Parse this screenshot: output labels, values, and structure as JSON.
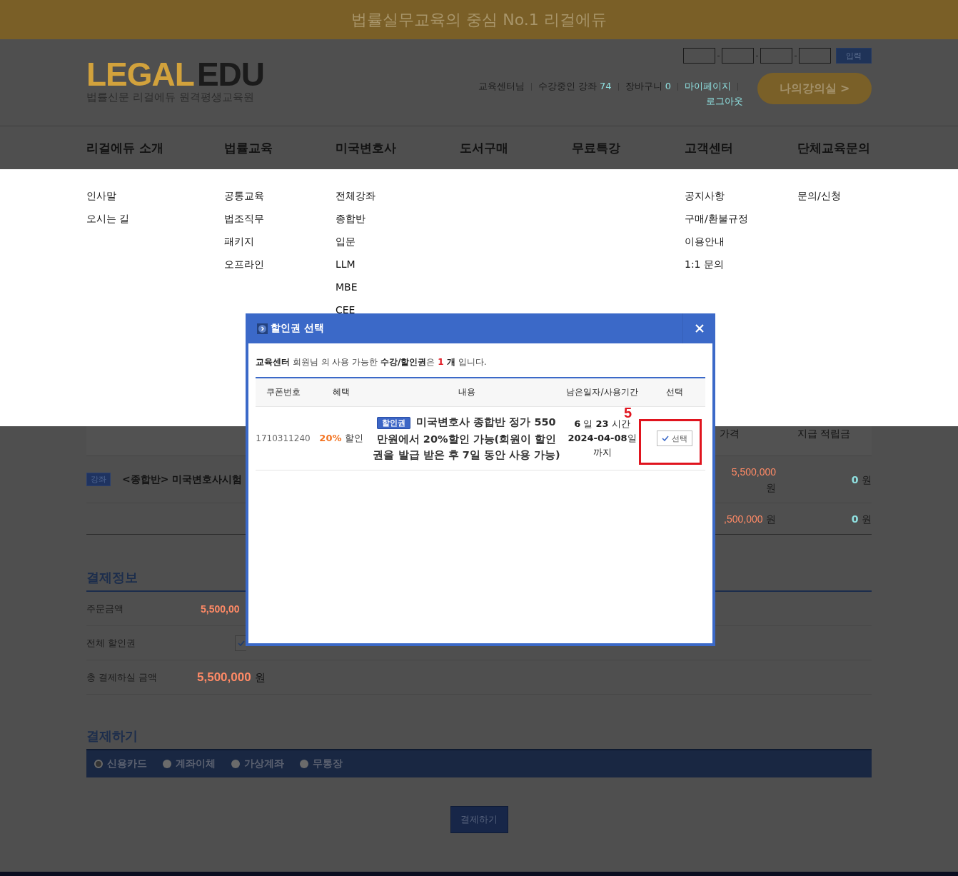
{
  "banner": {
    "text": "법률실무교육의 중심 No.1 리걸에듀"
  },
  "header": {
    "logo": {
      "brand_a": "LEGAL",
      "brand_b": "EDU",
      "subtitle": "법률신문 리걸에듀 원격평생교육원"
    },
    "code_submit": "입력",
    "user_links": [
      {
        "kind": "plain",
        "label": "교육센터님"
      },
      {
        "kind": "count",
        "label": "수강중인 강좌",
        "count": "74"
      },
      {
        "kind": "count",
        "label": "장바구니",
        "count": "0"
      },
      {
        "kind": "link",
        "label": "마이페이지"
      },
      {
        "kind": "logout",
        "label": "로그아웃"
      }
    ],
    "classroom_button": "나의강의실 >"
  },
  "nav": [
    {
      "label": "리걸에듀 소개",
      "submenu": [
        "인사말",
        "오시는 길"
      ]
    },
    {
      "label": "법률교육",
      "submenu": [
        "공통교육",
        "법조직무",
        "패키지",
        "오프라인"
      ]
    },
    {
      "label": "미국변호사",
      "submenu": [
        "전체강좌",
        "종합반",
        "입문",
        "LLM",
        "MBE",
        "CEE"
      ]
    },
    {
      "label": "도서구매"
    },
    {
      "label": "무료특강"
    },
    {
      "label": "고객센터",
      "submenu": [
        "공지사항",
        "구매/환불규정",
        "이용안내",
        "1:1 문의"
      ]
    },
    {
      "label": "단체교육문의",
      "submenu": [
        "문의/신청"
      ]
    }
  ],
  "cart_table": {
    "columns": [
      "가격",
      "지급 적립금"
    ],
    "item": {
      "badge": "강좌",
      "title": "<종합반> 미국변호사시험",
      "price": "5,500,000",
      "price_unit": "원",
      "points": "0",
      "points_unit": "원"
    },
    "total": {
      "price": ",500,000",
      "price_unit": "원",
      "points": "0",
      "points_unit": "원"
    }
  },
  "payment_info": {
    "title": "결제정보",
    "rows": [
      {
        "kind": "amount",
        "label": "주문금액",
        "value": "5,500,00"
      },
      {
        "kind": "coupon",
        "label": "전체 할인권"
      },
      {
        "kind": "total",
        "label": "총 결제하실 금액",
        "value": "5,500,000",
        "unit": "원"
      }
    ]
  },
  "payment": {
    "title": "결제하기",
    "methods": [
      {
        "label": "신용카드",
        "selected": true
      },
      {
        "label": "계좌이체",
        "selected": false
      },
      {
        "label": "가상계좌",
        "selected": false
      },
      {
        "label": "무통장",
        "selected": false
      }
    ],
    "submit": "결제하기"
  },
  "modal": {
    "title": "할인권 선택",
    "notice": [
      {
        "kind": "bold",
        "text": "교육센터"
      },
      {
        "kind": "plain",
        "text": " 회원님 의 사용 가능한 "
      },
      {
        "kind": "bold",
        "text": "수강/할인권"
      },
      {
        "kind": "plain",
        "text": "은 "
      },
      {
        "kind": "count",
        "text": "1"
      },
      {
        "kind": "bold",
        "text": " 개"
      },
      {
        "kind": "plain",
        "text": " 입니다."
      }
    ],
    "columns": [
      "쿠폰번호",
      "혜택",
      "내용",
      "남은일자/사용기간",
      "선택"
    ],
    "rows": [
      {
        "coupon_no": "1710311240",
        "benefit_value": "20%",
        "benefit_label": "할인",
        "badge": "할인권",
        "description": "미국변호사 종합반 정가 550 만원에서 20%할인 가능(회원이 할인권을 발급 받은 후 7일 동안 사용 가능)",
        "remaining": [
          "**6** 일 **23** 시간",
          "**2024-04-08**일",
          "까지"
        ],
        "select_label": "선택"
      }
    ],
    "annotation": "5"
  }
}
